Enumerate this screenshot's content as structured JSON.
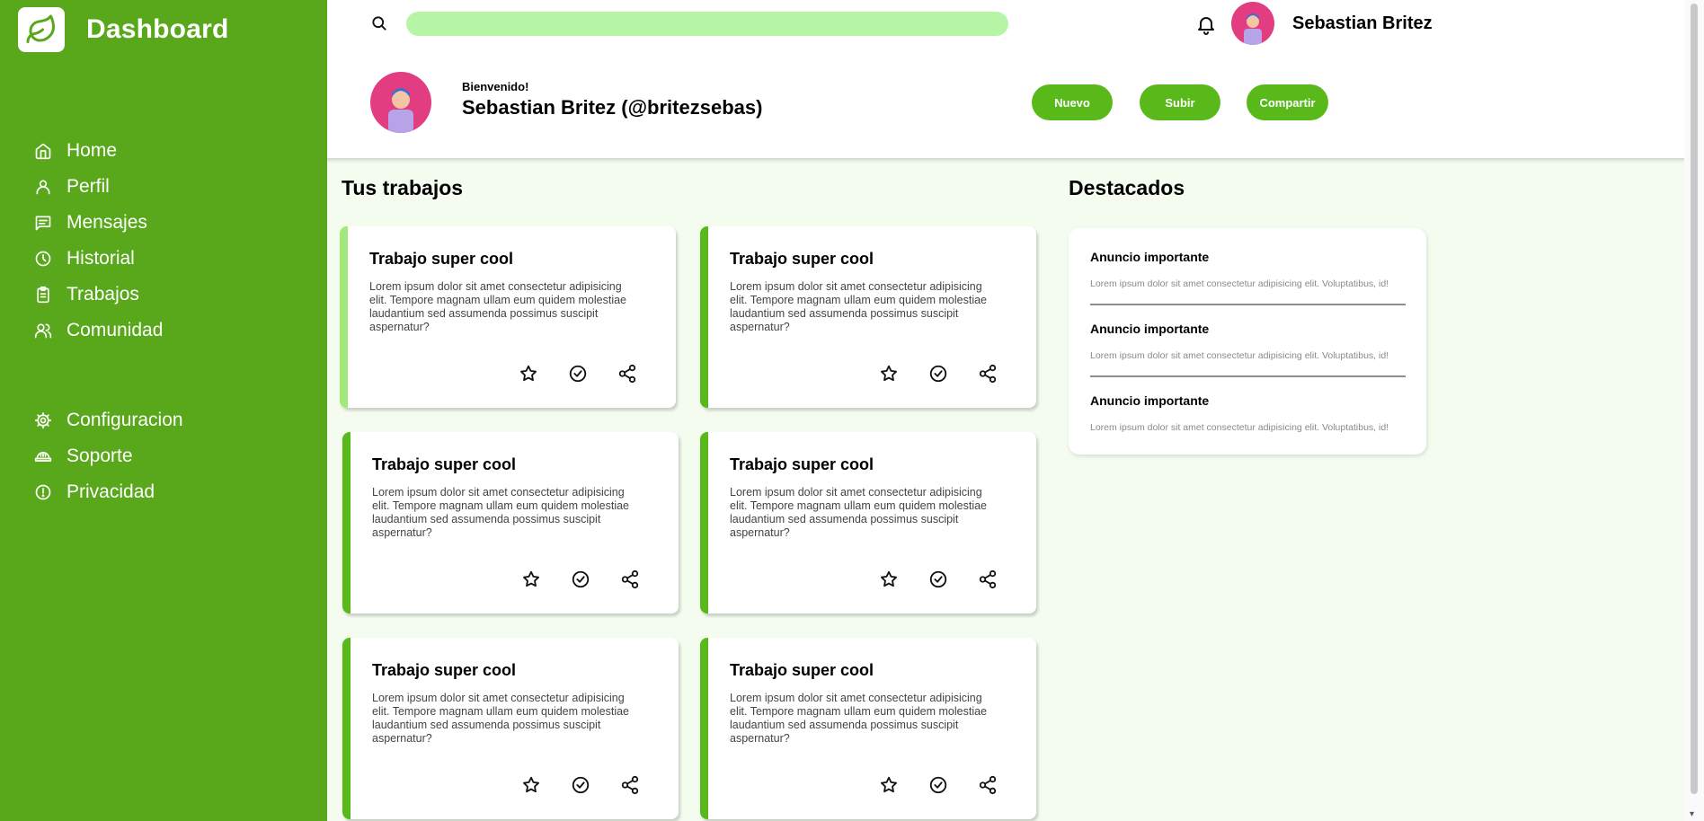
{
  "app": {
    "title": "Dashboard",
    "accent_color": "#59a81b",
    "button_color": "#59b91b",
    "search_color": "#b6f5a6"
  },
  "sidebar": {
    "primary": [
      {
        "icon": "home-icon",
        "label": "Home"
      },
      {
        "icon": "user-icon",
        "label": "Perfil"
      },
      {
        "icon": "message-icon",
        "label": "Mensajes"
      },
      {
        "icon": "clock-icon",
        "label": "Historial"
      },
      {
        "icon": "clipboard-icon",
        "label": "Trabajos"
      },
      {
        "icon": "users-icon",
        "label": "Comunidad"
      }
    ],
    "secondary": [
      {
        "icon": "gear-icon",
        "label": "Configuracion"
      },
      {
        "icon": "support-helmet-icon",
        "label": "Soporte"
      },
      {
        "icon": "privacy-icon",
        "label": "Privacidad"
      }
    ]
  },
  "header": {
    "search": {
      "value": "",
      "placeholder": ""
    },
    "username": "Sebastian Britez",
    "greeting": "Bienvenido!",
    "full_name": "Sebastian Britez (@britezsebas)",
    "buttons": {
      "nuevo": "Nuevo",
      "subir": "Subir",
      "compartir": "Compartir"
    }
  },
  "works": {
    "title": "Tus trabajos",
    "cards": [
      {
        "title": "Trabajo super cool",
        "text": "Lorem ipsum dolor sit amet consectetur adipisicing elit. Tempore magnam ullam eum quidem molestiae laudantium sed assumenda possimus suscipit aspernatur?"
      },
      {
        "title": "Trabajo super cool",
        "text": "Lorem ipsum dolor sit amet consectetur adipisicing elit. Tempore magnam ullam eum quidem molestiae laudantium sed assumenda possimus suscipit aspernatur?"
      },
      {
        "title": "Trabajo super cool",
        "text": "Lorem ipsum dolor sit amet consectetur adipisicing elit. Tempore magnam ullam eum quidem molestiae laudantium sed assumenda possimus suscipit aspernatur?"
      },
      {
        "title": "Trabajo super cool",
        "text": "Lorem ipsum dolor sit amet consectetur adipisicing elit. Tempore magnam ullam eum quidem molestiae laudantium sed assumenda possimus suscipit aspernatur?"
      },
      {
        "title": "Trabajo super cool",
        "text": "Lorem ipsum dolor sit amet consectetur adipisicing elit. Tempore magnam ullam eum quidem molestiae laudantium sed assumenda possimus suscipit aspernatur?"
      },
      {
        "title": "Trabajo super cool",
        "text": "Lorem ipsum dolor sit amet consectetur adipisicing elit. Tempore magnam ullam eum quidem molestiae laudantium sed assumenda possimus suscipit aspernatur?"
      }
    ],
    "card_actions": [
      "star-icon",
      "check-circle-icon",
      "share-icon"
    ]
  },
  "featured": {
    "title": "Destacados",
    "items": [
      {
        "title": "Anuncio importante",
        "text": "Lorem ipsum dolor sit amet consectetur adipisicing elit. Voluptatibus, id!"
      },
      {
        "title": "Anuncio importante",
        "text": "Lorem ipsum dolor sit amet consectetur adipisicing elit. Voluptatibus, id!"
      },
      {
        "title": "Anuncio importante",
        "text": "Lorem ipsum dolor sit amet consectetur adipisicing elit. Voluptatibus, id!"
      }
    ]
  }
}
